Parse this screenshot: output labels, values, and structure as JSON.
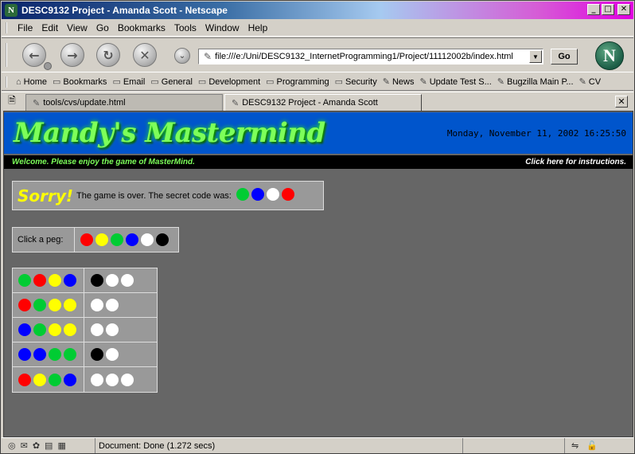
{
  "window": {
    "title": "DESC9132 Project - Amanda Scott - Netscape",
    "app_icon": "N",
    "buttons": {
      "minimize": "_",
      "maximize": "□",
      "close": "✕"
    }
  },
  "menu": [
    "File",
    "Edit",
    "View",
    "Go",
    "Bookmarks",
    "Tools",
    "Window",
    "Help"
  ],
  "nav": {
    "back_icon": "arrow-left-icon",
    "forward_icon": "arrow-right-icon",
    "reload_icon": "reload-icon",
    "stop_icon": "stop-icon",
    "url": "file:///e:/Uni/DESC9132_InternetProgramming1/Project/11112002b/index.html",
    "go_label": "Go",
    "logo_letter": "N"
  },
  "personal_toolbar": [
    {
      "label": "Home",
      "icon": "home-icon",
      "glyph": "⌂"
    },
    {
      "label": "Bookmarks",
      "icon": "folder-icon",
      "glyph": "▭"
    },
    {
      "label": "Email",
      "icon": "folder-icon",
      "glyph": "▭"
    },
    {
      "label": "General",
      "icon": "folder-icon",
      "glyph": "▭"
    },
    {
      "label": "Development",
      "icon": "folder-icon",
      "glyph": "▭"
    },
    {
      "label": "Programming",
      "icon": "folder-icon",
      "glyph": "▭"
    },
    {
      "label": "Security",
      "icon": "folder-icon",
      "glyph": "▭"
    },
    {
      "label": "News",
      "icon": "bookmark-icon",
      "glyph": "✎"
    },
    {
      "label": "Update Test S...",
      "icon": "bookmark-icon",
      "glyph": "✎"
    },
    {
      "label": "Bugzilla Main P...",
      "icon": "bookmark-icon",
      "glyph": "✎"
    },
    {
      "label": "CV",
      "icon": "bookmark-icon",
      "glyph": "✎"
    }
  ],
  "tabs": [
    {
      "label": "tools/cvs/update.html",
      "active": false
    },
    {
      "label": "DESC9132 Project - Amanda Scott",
      "active": true
    }
  ],
  "page": {
    "logo": "Mandy's Mastermind",
    "datetime": "Monday, November 11, 2002 16:25:50",
    "welcome": "Welcome. Please enjoy the game of MasterMind.",
    "instructions": "Click here for instructions.",
    "sorry": "Sorry!",
    "game_over": "The game is over. The secret code was:",
    "secret_code": [
      "#00cc33",
      "#0000ff",
      "#ffffff",
      "#ff0000"
    ],
    "click_peg_label": "Click a peg:",
    "peg_choices": [
      "#ff0000",
      "#ffff00",
      "#00cc33",
      "#0000ff",
      "#ffffff",
      "#000000"
    ],
    "guesses": [
      {
        "pegs": [
          "#00cc33",
          "#ff0000",
          "#ffff00",
          "#0000ff"
        ],
        "score": [
          "#000000",
          "#ffffff",
          "#ffffff"
        ]
      },
      {
        "pegs": [
          "#ff0000",
          "#00cc33",
          "#ffff00",
          "#ffff00"
        ],
        "score": [
          "#ffffff",
          "#ffffff"
        ]
      },
      {
        "pegs": [
          "#0000ff",
          "#00cc33",
          "#ffff00",
          "#ffff00"
        ],
        "score": [
          "#ffffff",
          "#ffffff"
        ]
      },
      {
        "pegs": [
          "#0000ff",
          "#0000ff",
          "#00cc33",
          "#00cc33"
        ],
        "score": [
          "#000000",
          "#ffffff"
        ]
      },
      {
        "pegs": [
          "#ff0000",
          "#ffff00",
          "#00cc33",
          "#0000ff"
        ],
        "score": [
          "#ffffff",
          "#ffffff",
          "#ffffff"
        ]
      }
    ]
  },
  "status": {
    "text": "Document: Done (1.272 secs)"
  },
  "colors": {
    "content_bg": "#666666",
    "header_bg": "#0055cc",
    "logo_green": "#7dff5a"
  }
}
